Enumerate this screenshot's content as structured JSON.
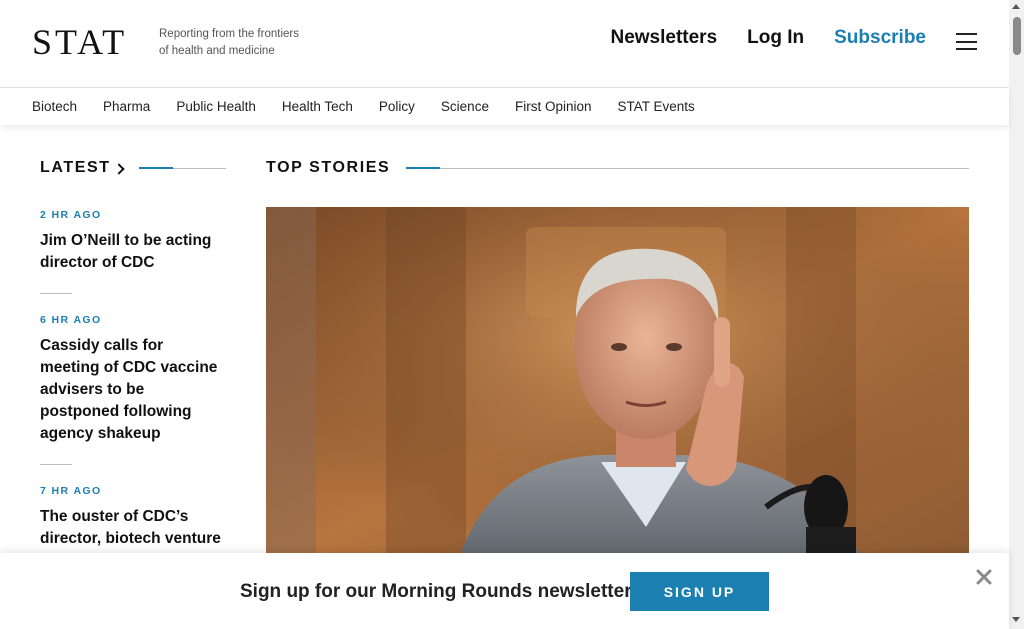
{
  "header": {
    "logo": "STAT",
    "tagline_line1": "Reporting from the frontiers",
    "tagline_line2": "of health and medicine",
    "links": {
      "newsletters": "Newsletters",
      "login": "Log In",
      "subscribe": "Subscribe"
    }
  },
  "nav": {
    "items": [
      "Biotech",
      "Pharma",
      "Public Health",
      "Health Tech",
      "Policy",
      "Science",
      "First Opinion",
      "STAT Events"
    ]
  },
  "latest": {
    "title": "LATEST",
    "items": [
      {
        "time": "2 HR AGO",
        "headline": "Jim O’Neill to be acting director of CDC"
      },
      {
        "time": "6 HR AGO",
        "headline": "Cassidy calls for meeting of CDC vaccine advisers to be postponed following agency shakeup"
      },
      {
        "time": "7 HR AGO",
        "headline": "The ouster of CDC’s director, biotech venture"
      }
    ]
  },
  "top_stories": {
    "title": "TOP STORIES"
  },
  "newsletter_bar": {
    "text": "Sign up for our Morning Rounds newsletter",
    "button": "SIGN UP"
  },
  "colors": {
    "accent": "#1b7fb2",
    "text": "#111111"
  }
}
